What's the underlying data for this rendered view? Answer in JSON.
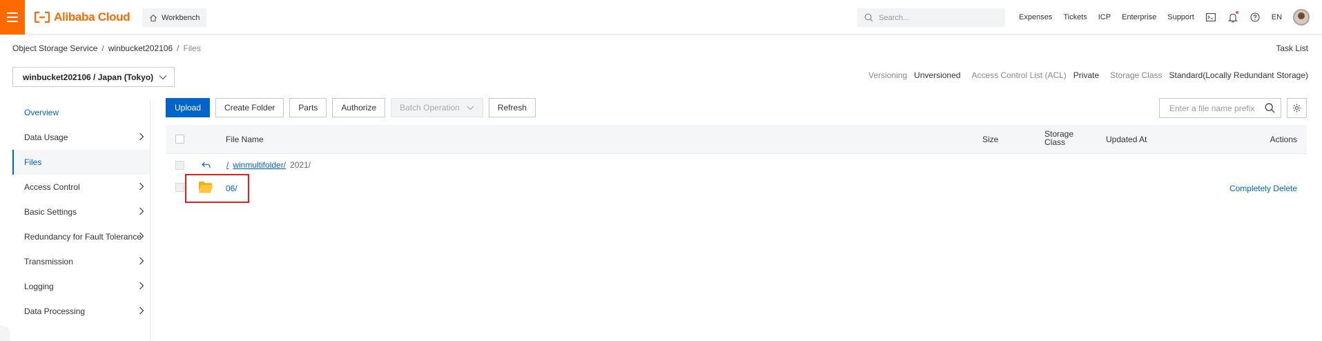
{
  "topbar": {
    "brand": "Alibaba Cloud",
    "workbench": "Workbench",
    "search_placeholder": "Search...",
    "nav": [
      "Expenses",
      "Tickets",
      "ICP",
      "Enterprise",
      "Support"
    ],
    "lang": "EN",
    "brand_color": "#ff6a00"
  },
  "breadcrumb": {
    "items": [
      "Object Storage Service",
      "winbucket202106",
      "Files"
    ],
    "separator": "/"
  },
  "task_list": "Task List",
  "bucket": {
    "selected": "winbucket202106 / Japan (Tokyo)",
    "info": [
      {
        "label": "Versioning",
        "value": "Unversioned"
      },
      {
        "label": "Access Control List (ACL)",
        "value": "Private"
      },
      {
        "label": "Storage Class",
        "value": "Standard(Locally Redundant Storage)"
      }
    ]
  },
  "sidebar": {
    "items": [
      {
        "label": "Overview"
      },
      {
        "label": "Data Usage"
      },
      {
        "label": "Files"
      },
      {
        "label": "Access Control"
      },
      {
        "label": "Basic Settings"
      },
      {
        "label": "Redundancy for Fault Tolerance"
      },
      {
        "label": "Transmission"
      },
      {
        "label": "Logging"
      },
      {
        "label": "Data Processing"
      }
    ]
  },
  "toolbar": {
    "upload": "Upload",
    "create_folder": "Create Folder",
    "parts": "Parts",
    "authorize": "Authorize",
    "batch_operation": "Batch Operation",
    "refresh": "Refresh",
    "search_placeholder": "Enter a file name prefix"
  },
  "table": {
    "headers": {
      "file_name": "File Name",
      "size": "Size",
      "storage_class_1": "Storage",
      "storage_class_2": "Class",
      "updated_at": "Updated At",
      "actions": "Actions"
    },
    "path_row": {
      "root": "/",
      "folder": "winmultifolder/",
      "sub": "2021/"
    },
    "rows": [
      {
        "name": "06/",
        "action": "Completely Delete"
      }
    ]
  },
  "colors": {
    "accent": "#0064c8",
    "highlight": "#e02020",
    "folder": "#ffc53d"
  }
}
